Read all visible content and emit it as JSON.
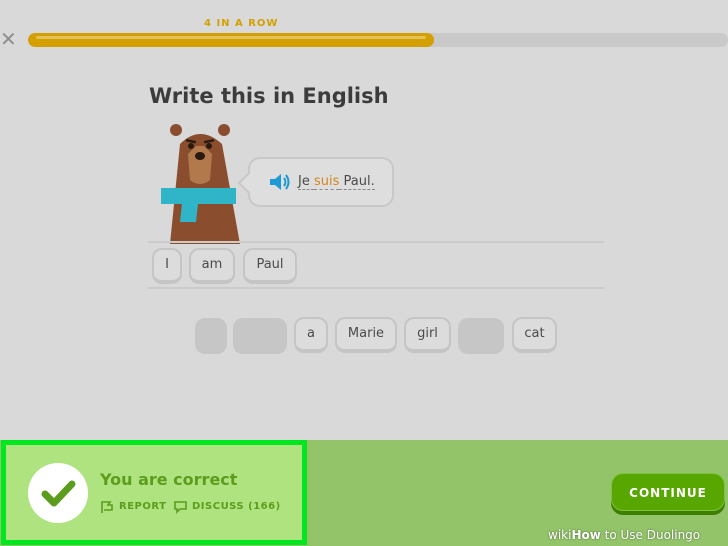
{
  "header": {
    "close_icon": "close-icon",
    "streak_label": "4 IN A ROW",
    "progress": 0.58,
    "progress_color": "#d4a000"
  },
  "prompt": {
    "title": "Write this in English",
    "speaker_icon": "speaker-icon",
    "sentence_pre": "Je ",
    "sentence_highlight": "suis",
    "sentence_post": " Paul."
  },
  "answer": {
    "words": [
      "I",
      "am",
      "Paul"
    ]
  },
  "word_bank": {
    "words": [
      "a",
      "Marie",
      "girl",
      "cat"
    ]
  },
  "feedback": {
    "message": "You are correct",
    "report_label": "REPORT",
    "discuss_label": "DISCUSS (166)",
    "accent_color": "#5c9d1e",
    "highlight_border": "#00e61f"
  },
  "continue_label": "CONTINUE",
  "watermark": {
    "wiki": "wiki",
    "how": "How",
    "rest": " to Use Duolingo"
  }
}
